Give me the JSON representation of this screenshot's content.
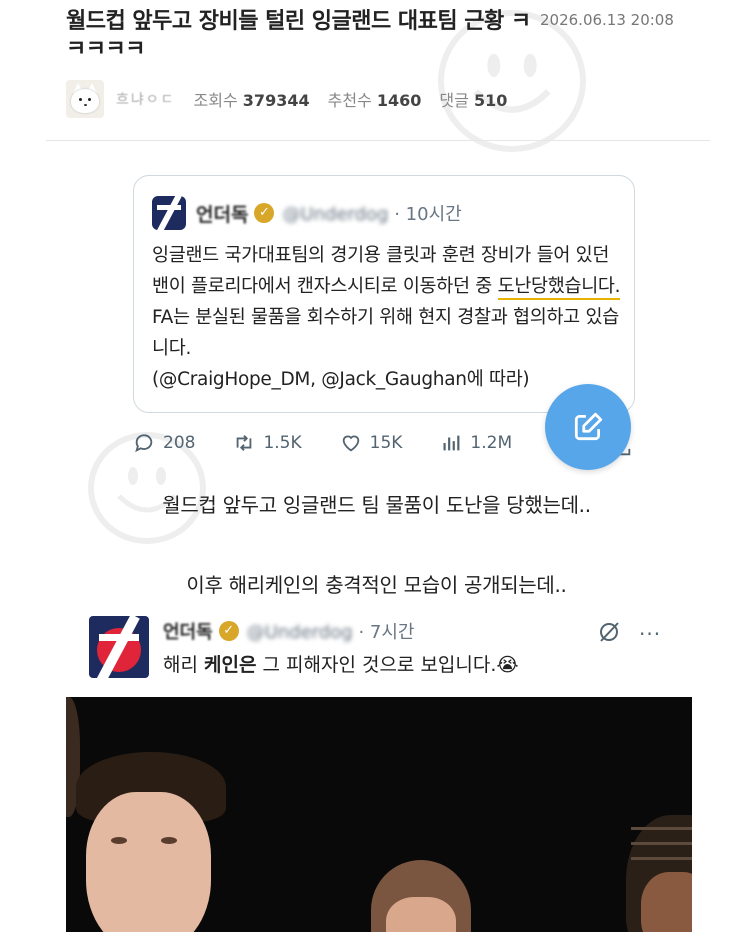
{
  "post": {
    "title": "월드컵 앞두고 장비들 털린 잉글랜드 대표팀 근황 ㅋㅋㅋㅋㅋ",
    "date": "2026.06.13 20:08",
    "author": "흐냐ㅇㄷ",
    "views_label": "조회수",
    "views": "379344",
    "likes_label": "추천수",
    "likes": "1460",
    "comments_label": "댓글",
    "comments": "510"
  },
  "quote_tweet": {
    "name": "언더독",
    "handle": "@Underdog",
    "time": "· 10시간",
    "text_before": "잉글랜드 국가대표팀의 경기용 클릿과 훈련 장비가 들어 있던 밴이 플로리다에서 캔자스시티로 이동하던 중 ",
    "text_underlined": "도난당했습니다.",
    "text_after": " FA는 분실된 물품을 회수하기 위해 현지 경찰과 협의하고 있습니다.",
    "text_source": "(@CraigHope_DM, @Jack_Gaughan에 따라)"
  },
  "actions": {
    "replies": "208",
    "retweets": "1.5K",
    "likes": "15K",
    "views": "1.2M"
  },
  "captions": {
    "first": "월드컵 앞두고 잉글랜드 팀 물품이 도난을 당했는데..",
    "second": "이후 해리케인의 충격적인 모습이 공개되는데.."
  },
  "tweet2": {
    "name": "언더독",
    "handle": "@Underdog",
    "time": "· 7시간",
    "text_before": "해리 ",
    "text_bold": "케인은",
    "text_after": " 그 피해자인 것으로 보입니다.",
    "emoji": "😭",
    "more": "···"
  },
  "colors": {
    "accent_blue": "#58a6ea",
    "underline_yellow": "#e8b400",
    "verified_gold": "#d8a628",
    "logo_navy": "#1d2b5e"
  },
  "icons": [
    "reply-icon",
    "retweet-icon",
    "heart-icon",
    "views-icon",
    "bookmark-icon",
    "share-icon",
    "compose-icon",
    "grok-icon",
    "more-icon",
    "verified-icon"
  ]
}
